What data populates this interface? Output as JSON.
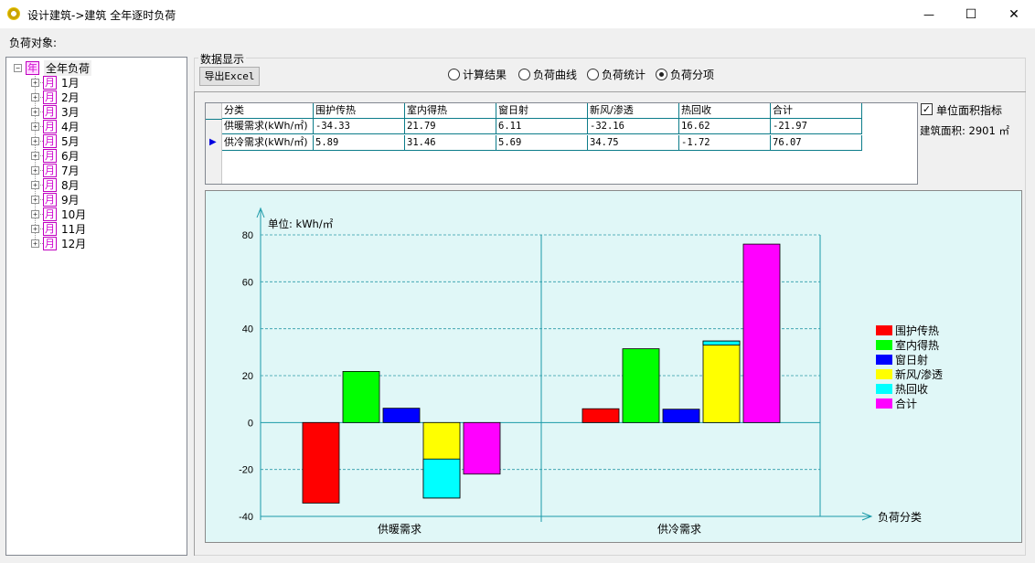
{
  "window": {
    "title": "设计建筑->建筑 全年逐时负荷",
    "controls": {
      "minimize": "—",
      "maximize": "☐",
      "close": "✕"
    }
  },
  "left_panel": {
    "label": "负荷对象:",
    "tree": {
      "root": {
        "toggle": "−",
        "icon": "年",
        "label": "全年负荷"
      },
      "months": [
        {
          "toggle": "+",
          "icon": "月",
          "label": "1月"
        },
        {
          "toggle": "+",
          "icon": "月",
          "label": "2月"
        },
        {
          "toggle": "+",
          "icon": "月",
          "label": "3月"
        },
        {
          "toggle": "+",
          "icon": "月",
          "label": "4月"
        },
        {
          "toggle": "+",
          "icon": "月",
          "label": "5月"
        },
        {
          "toggle": "+",
          "icon": "月",
          "label": "6月"
        },
        {
          "toggle": "+",
          "icon": "月",
          "label": "7月"
        },
        {
          "toggle": "+",
          "icon": "月",
          "label": "8月"
        },
        {
          "toggle": "+",
          "icon": "月",
          "label": "9月"
        },
        {
          "toggle": "+",
          "icon": "月",
          "label": "10月"
        },
        {
          "toggle": "+",
          "icon": "月",
          "label": "11月"
        },
        {
          "toggle": "+",
          "icon": "月",
          "label": "12月"
        }
      ]
    }
  },
  "data_panel": {
    "group_title": "数据显示",
    "export_button": "导出Excel",
    "view_options": [
      {
        "label": "计算结果",
        "selected": false
      },
      {
        "label": "负荷曲线",
        "selected": false
      },
      {
        "label": "负荷统计",
        "selected": false
      },
      {
        "label": "负荷分项",
        "selected": true
      }
    ],
    "unit_area_checkbox": {
      "label": "单位面积指标",
      "checked": true,
      "mark": "✓"
    },
    "building_area": "建筑面积: 2901 ㎡"
  },
  "table": {
    "headers": [
      "分类",
      "围护传热",
      "室内得热",
      "窗日射",
      "新风/渗透",
      "热回收",
      "合计"
    ],
    "rows": [
      {
        "cells": [
          "供暖需求(kWh/㎡)",
          "-34.33",
          "21.79",
          "6.11",
          "-32.16",
          "16.62",
          "-21.97"
        ],
        "current": false
      },
      {
        "cells": [
          "供冷需求(kWh/㎡)",
          "5.89",
          "31.46",
          "5.69",
          "34.75",
          "-1.72",
          "76.07"
        ],
        "current": true
      }
    ],
    "current_row_marker": "▶"
  },
  "colors": {
    "chart_bg": "#e0f7f7",
    "axis": "#1a9aa8",
    "grid": "#2a9aa8"
  },
  "chart_data": {
    "type": "bar",
    "unit_label": "单位: kWh/㎡",
    "xlabel": "负荷分类",
    "ylim": [
      -40,
      80
    ],
    "yticks": [
      80,
      60,
      40,
      20,
      0,
      -20,
      -40
    ],
    "categories": [
      "供暖需求",
      "供冷需求"
    ],
    "series": [
      {
        "name": "围护传热",
        "color": "#ff0000",
        "values": [
          -34.33,
          5.89
        ]
      },
      {
        "name": "室内得热",
        "color": "#00ff00",
        "values": [
          21.79,
          31.46
        ]
      },
      {
        "name": "窗日射",
        "color": "#0000ff",
        "values": [
          6.11,
          5.69
        ]
      },
      {
        "name": "新风/渗透",
        "color": "#ffff00",
        "values": [
          -32.16,
          34.75
        ]
      },
      {
        "name": "热回收",
        "color": "#00ffff",
        "values": [
          16.62,
          -1.72
        ]
      },
      {
        "name": "合计",
        "color": "#ff00ff",
        "values": [
          -21.97,
          76.07
        ]
      }
    ],
    "stacked_note": "新风/渗透 and 热回收 share one stacked column",
    "grid": true,
    "legend_position": "right"
  }
}
